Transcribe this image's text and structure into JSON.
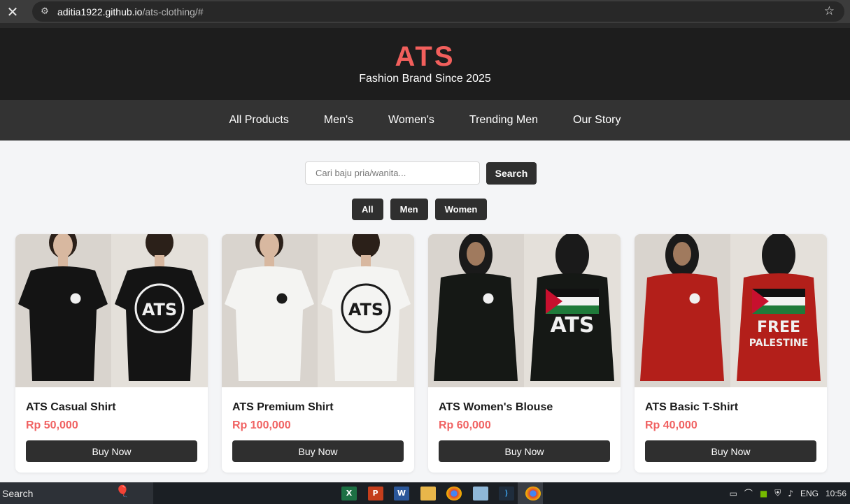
{
  "browser": {
    "url_host": "aditia1922.github.io",
    "url_path": "/ats-clothing/#"
  },
  "header": {
    "brand": "ATS",
    "tagline": "Fashion Brand Since 2025"
  },
  "nav": {
    "items": [
      "All Products",
      "Men's",
      "Women's",
      "Trending Men",
      "Our Story"
    ]
  },
  "search": {
    "placeholder": "Cari baju pria/wanita...",
    "button_label": "Search"
  },
  "filters": [
    "All",
    "Men",
    "Women"
  ],
  "products": [
    {
      "name": "ATS Casual Shirt",
      "price": "Rp 50,000",
      "buy_label": "Buy Now",
      "shirt_color": "#141414",
      "print_color": "#f0f0f0",
      "back_text": "ATS"
    },
    {
      "name": "ATS Premium Shirt",
      "price": "Rp 100,000",
      "buy_label": "Buy Now",
      "shirt_color": "#f4f4f2",
      "print_color": "#1a1a1a",
      "back_text": "ATS"
    },
    {
      "name": "ATS Women's Blouse",
      "price": "Rp 60,000",
      "buy_label": "Buy Now",
      "shirt_color": "#151815",
      "print_color": "#f0f0f0",
      "back_text": "ATS"
    },
    {
      "name": "ATS Basic T-Shirt",
      "price": "Rp 40,000",
      "buy_label": "Buy Now",
      "shirt_color": "#b31f1a",
      "print_color": "#f0f0f0",
      "back_text": "FREE\nPALESTINE"
    }
  ],
  "taskbar": {
    "search_label": "Search",
    "lang": "ENG",
    "time": "10:56"
  },
  "colors": {
    "brand_accent": "#f25f5c",
    "price": "#f06262",
    "button": "#2f2f2f"
  }
}
